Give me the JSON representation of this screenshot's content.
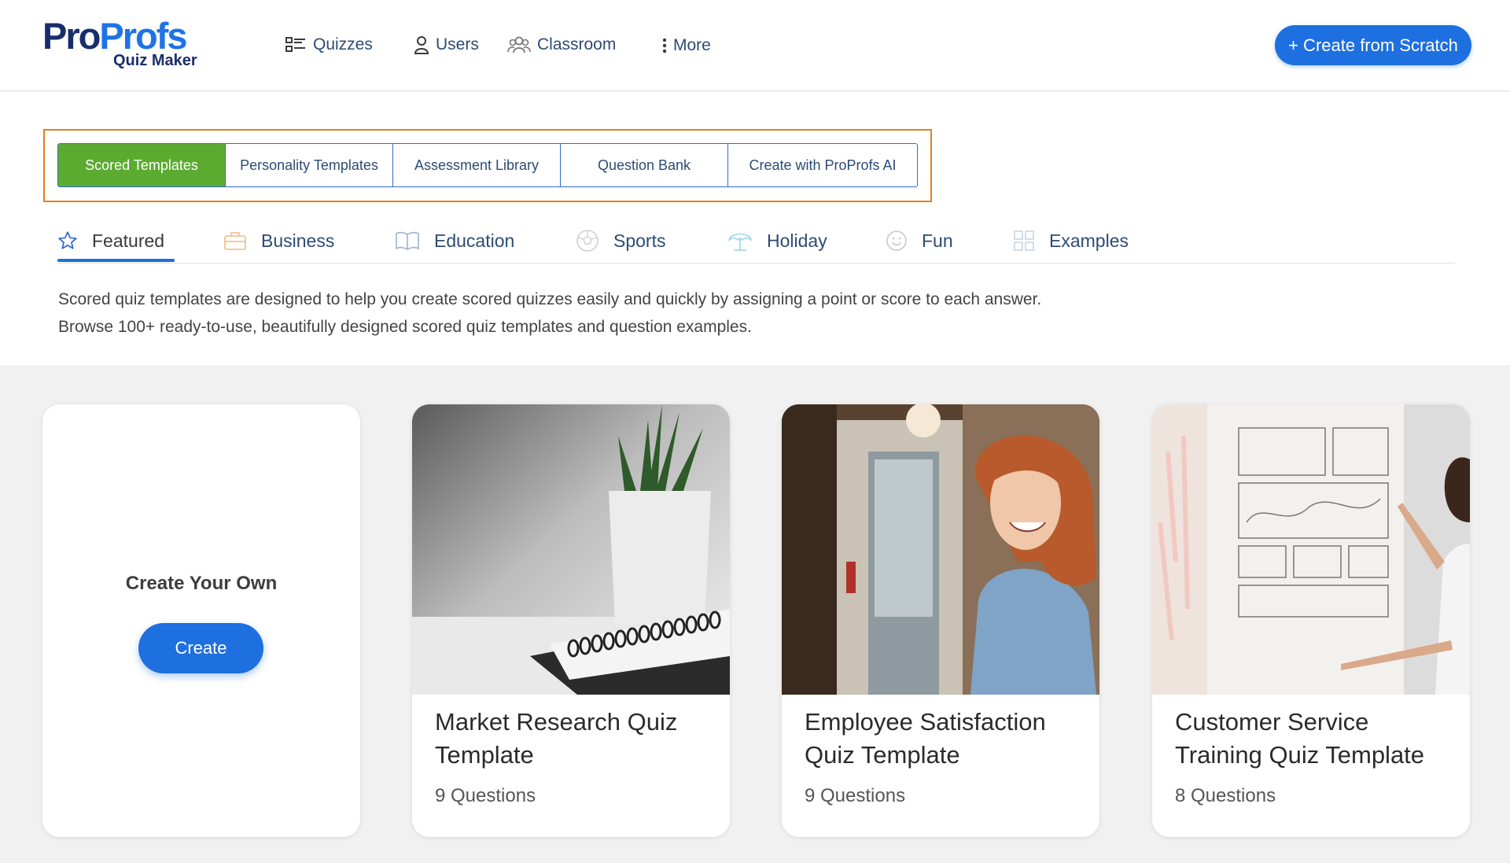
{
  "brand": {
    "logo_pro": "Pro",
    "logo_profs": "Profs",
    "logo_sub": "Quiz Maker"
  },
  "nav": [
    {
      "label": "Quizzes",
      "icon": "quizzes-icon"
    },
    {
      "label": "Users",
      "icon": "user-icon"
    },
    {
      "label": "Classroom",
      "icon": "classroom-icon"
    },
    {
      "label": "More",
      "icon": "more-vertical-icon"
    }
  ],
  "create_scratch_label": "+ Create from Scratch",
  "template_tabs": [
    {
      "label": "Scored Templates",
      "active": true
    },
    {
      "label": "Personality Templates",
      "active": false
    },
    {
      "label": "Assessment Library",
      "active": false
    },
    {
      "label": "Question Bank",
      "active": false
    },
    {
      "label": "Create with ProProfs AI",
      "active": false
    }
  ],
  "categories": [
    {
      "label": "Featured",
      "icon": "star-icon",
      "active": true
    },
    {
      "label": "Business",
      "icon": "briefcase-icon"
    },
    {
      "label": "Education",
      "icon": "book-icon"
    },
    {
      "label": "Sports",
      "icon": "ball-icon"
    },
    {
      "label": "Holiday",
      "icon": "umbrella-icon"
    },
    {
      "label": "Fun",
      "icon": "smiley-icon"
    },
    {
      "label": "Examples",
      "icon": "grid-icon"
    }
  ],
  "description": {
    "line1": "Scored quiz templates are designed to help you create scored quizzes easily and quickly by assigning a point or score to each answer.",
    "line2": "Browse 100+ ready-to-use, beautifully designed scored quiz templates and question examples."
  },
  "create_own": {
    "title": "Create Your Own",
    "button": "Create"
  },
  "cards": [
    {
      "title": "Market Research Quiz Template",
      "questions": "9 Questions"
    },
    {
      "title": "Employee Satisfaction Quiz Template",
      "questions": "9 Questions"
    },
    {
      "title": "Customer Service Training Quiz Template",
      "questions": "8 Questions"
    }
  ],
  "colors": {
    "accent": "#1e6fe0",
    "active_tab": "#5cab31",
    "highlight": "#e67e22",
    "nav_text": "#2d4b74"
  }
}
